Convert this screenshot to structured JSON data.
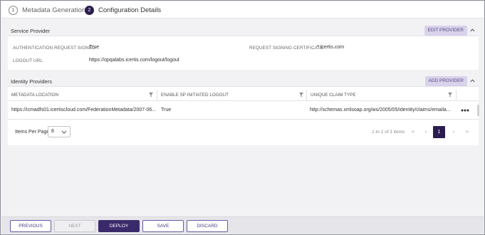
{
  "stepper": {
    "steps": [
      {
        "number": "1",
        "label": "Metadata Generation"
      },
      {
        "number": "2",
        "label": "Configuration Details"
      }
    ]
  },
  "service_provider": {
    "title": "Service Provider",
    "edit_label": "EDIT PROVIDER",
    "fields": {
      "auth_request_signed_label": "AUTHENTICATION REQUEST SIGNED",
      "auth_request_signed_value": "True",
      "request_signing_cert_label": "REQUEST SIGNING CERTIFICATE",
      "request_signing_cert_value": "*.icertis.com",
      "logout_url_label": "LOGOUT URL",
      "logout_url_value": "https://opqalabs.icertis.com/logout/logout"
    }
  },
  "identity_providers": {
    "title": "Identity Providers",
    "add_label": "ADD PROVIDER",
    "columns": [
      "METADATA LOCATION",
      "ENABLE SP INITIATED LOGOUT",
      "UNIQUE CLAIM TYPE"
    ],
    "rows": [
      {
        "metadata_location": "https://icmadfs01.icertiscloud.com/FederationMetadata/2007-06...",
        "enable_sp_logout": "True",
        "unique_claim_type": "http://schemas.xmlsoap.org/ws/2005/05/identity/claims/emaila..."
      }
    ],
    "pager": {
      "items_per_page_label": "Items Per Page",
      "items_per_page_value": "8",
      "range_text": "1 to 1 of 1 items",
      "current_page": "1",
      "first": "«",
      "prev": "‹",
      "next": "›",
      "last": "»"
    }
  },
  "footer": {
    "previous": "PREVIOUS",
    "next": "NEXT",
    "deploy": "DEPLOY",
    "save": "SAVE",
    "discard": "DISCARD"
  },
  "colors": {
    "accent": "#2b1d4f",
    "header_button_bg": "#d9d2ea",
    "deploy_bg": "#3b2a6b"
  }
}
